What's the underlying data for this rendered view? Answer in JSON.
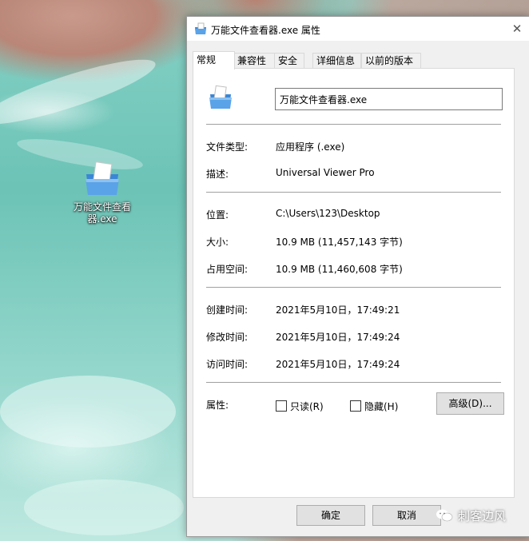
{
  "desktop": {
    "icon_label": "万能文件查看器.exe",
    "watermark": "刺客边风"
  },
  "window": {
    "title": "万能文件查看器.exe 属性",
    "close_glyph": "✕"
  },
  "tabs": [
    "常规",
    "兼容性",
    "安全",
    "详细信息",
    "以前的版本"
  ],
  "general": {
    "file_name": "万能文件查看器.exe",
    "rows": [
      {
        "label": "文件类型:",
        "value": "应用程序 (.exe)"
      },
      {
        "label": "描述:",
        "value": "Universal Viewer Pro"
      },
      {
        "label": "位置:",
        "value": "C:\\Users\\123\\Desktop"
      },
      {
        "label": "大小:",
        "value": "10.9 MB (11,457,143 字节)"
      },
      {
        "label": "占用空间:",
        "value": "10.9 MB (11,460,608 字节)"
      },
      {
        "label": "创建时间:",
        "value": "2021年5月10日，17:49:21"
      },
      {
        "label": "修改时间:",
        "value": "2021年5月10日，17:49:24"
      },
      {
        "label": "访问时间:",
        "value": "2021年5月10日，17:49:24"
      }
    ],
    "attributes_label": "属性:",
    "readonly_label": "只读(R)",
    "readonly_checked": false,
    "hidden_label": "隐藏(H)",
    "hidden_checked": false,
    "advanced_label": "高级(D)..."
  },
  "footer": {
    "ok_label": "确定",
    "cancel_label": "取消"
  },
  "colors": {
    "folder_blue": "#3b86d6",
    "folder_light": "#8cc1f0"
  }
}
